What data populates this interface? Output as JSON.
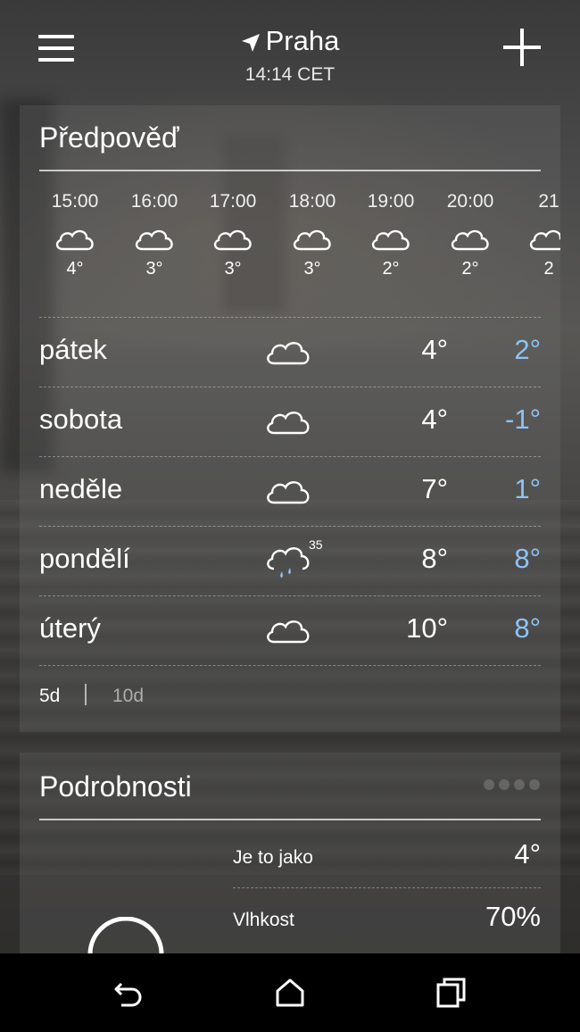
{
  "header": {
    "city": "Praha",
    "time": "14:14 CET"
  },
  "forecast": {
    "title": "Předpověď",
    "hourly": [
      {
        "time": "15:00",
        "temp": "4°",
        "icon": "cloud-icon"
      },
      {
        "time": "16:00",
        "temp": "3°",
        "icon": "cloud-icon"
      },
      {
        "time": "17:00",
        "temp": "3°",
        "icon": "cloud-icon"
      },
      {
        "time": "18:00",
        "temp": "3°",
        "icon": "cloud-icon"
      },
      {
        "time": "19:00",
        "temp": "2°",
        "icon": "cloud-icon"
      },
      {
        "time": "20:00",
        "temp": "2°",
        "icon": "cloud-icon"
      },
      {
        "time": "21",
        "temp": "2",
        "icon": "cloud-icon"
      }
    ],
    "daily": [
      {
        "day": "pátek",
        "high": "4°",
        "low": "2°",
        "icon": "cloud-icon",
        "precip": ""
      },
      {
        "day": "sobota",
        "high": "4°",
        "low": "-1°",
        "icon": "cloud-icon",
        "precip": ""
      },
      {
        "day": "neděle",
        "high": "7°",
        "low": "1°",
        "icon": "cloud-icon",
        "precip": ""
      },
      {
        "day": "pondělí",
        "high": "8°",
        "low": "8°",
        "icon": "rain-cloud-icon",
        "precip": "35"
      },
      {
        "day": "úterý",
        "high": "10°",
        "low": "8°",
        "icon": "cloud-icon",
        "precip": ""
      }
    ],
    "range_options": [
      "5d",
      "10d"
    ],
    "range_selected": "5d"
  },
  "details": {
    "title": "Podrobnosti",
    "rows": [
      {
        "label": "Je to jako",
        "value": "4°"
      },
      {
        "label": "Vlhkost",
        "value": "70%"
      }
    ]
  },
  "colors": {
    "low_temp": "#8fc3f5",
    "nav_bar": "#000000"
  }
}
